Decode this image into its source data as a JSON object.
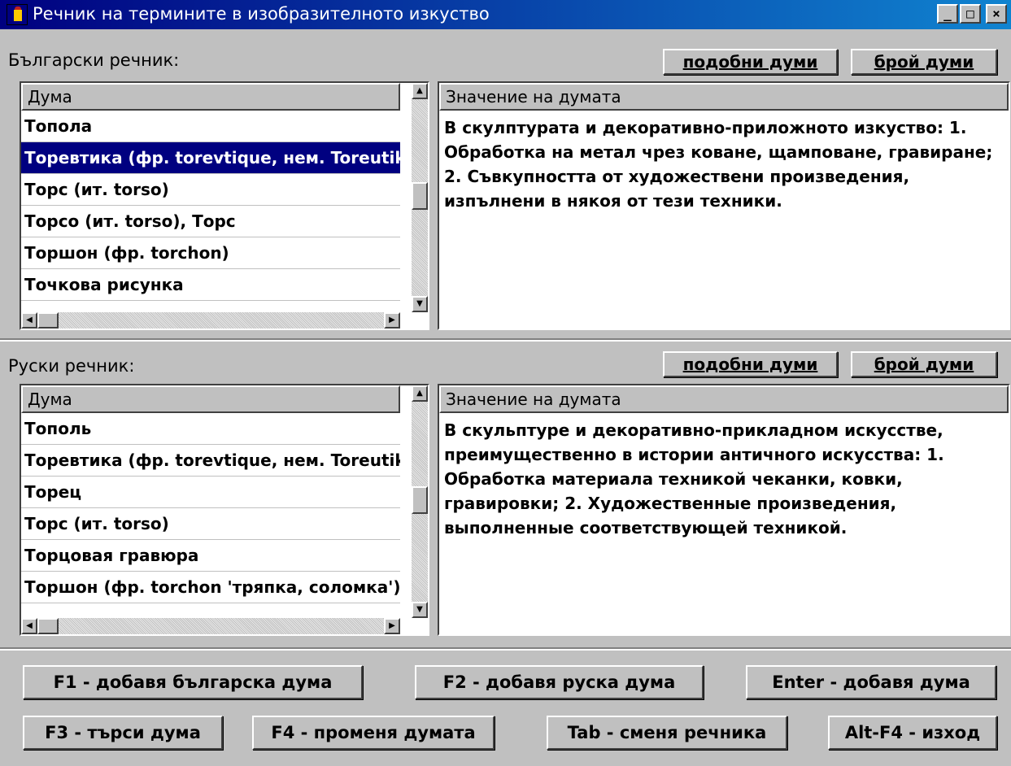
{
  "window": {
    "title": "Речник на термините в изобразителното изкуство",
    "minimize": "_",
    "maximize": "□",
    "close": "×"
  },
  "bulgarian": {
    "section_label": "Български речник:",
    "similar_button": "подобни думи",
    "count_button": "брой думи",
    "word_header": "Дума",
    "meaning_header": "Значение на думата",
    "words": [
      "Топола",
      "Торевтика (фр. torevtique, нем. Toreutik)",
      "Торс (ит. torso)",
      "Торсо (ит. torso), Торс",
      "Торшон (фр. torchon)",
      "Точкова рисунка"
    ],
    "selected_index": 1,
    "meaning": "В скулптурата и декоративно-приложното изкуство: 1. Обработка на метал чрез коване, щамповане, гравиране; 2. Съвкупността от художествени произведения, изпълнени в някоя от тези техники."
  },
  "russian": {
    "section_label": "Руски речник:",
    "similar_button": "подобни думи",
    "count_button": "брой думи",
    "word_header": "Дума",
    "meaning_header": "Значение на думата",
    "words": [
      "Тополь",
      "Торевтика (фр. torevtique, нем. Toreutik)",
      "Торец",
      "Торс (ит. torso)",
      "Торцовая гравюра",
      "Торшон (фр. torchon 'тряпка, соломка')"
    ],
    "meaning": "В скульптуре и декоративно-прикладном искусстве, преимущественно в истории античного искусства: 1. Обработка материала техникой чеканки, ковки, гравировки; 2. Художественные произведения, выполненные соответствующей техникой."
  },
  "footer": {
    "f1": "F1 - добавя българска дума",
    "f2": "F2 - добавя руска дума",
    "enter": "Enter - добавя дума",
    "f3": "F3 - търси дума",
    "f4": "F4 - променя думата",
    "tab": "Tab - сменя речника",
    "altf4": "Alt-F4 - изход"
  },
  "colors": {
    "title_bar": "#000080",
    "selection": "#000080",
    "face": "#c0c0c0"
  }
}
